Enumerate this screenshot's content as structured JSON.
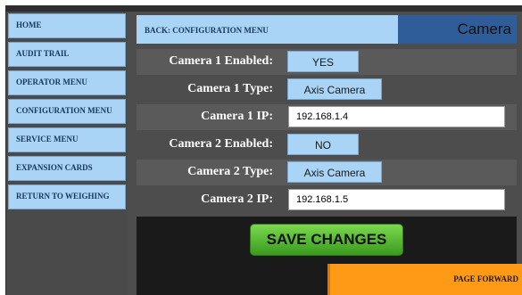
{
  "sidebar": {
    "items": [
      {
        "label": "HOME"
      },
      {
        "label": "AUDIT TRAIL"
      },
      {
        "label": "OPERATOR MENU"
      },
      {
        "label": "CONFIGURATION MENU"
      },
      {
        "label": "SERVICE MENU"
      },
      {
        "label": "EXPANSION CARDS"
      },
      {
        "label": "RETURN TO WEIGHING"
      }
    ]
  },
  "header": {
    "back_label": "BACK: CONFIGURATION MENU",
    "title": "Camera"
  },
  "settings": {
    "camera1_enabled": {
      "label": "Camera 1 Enabled:",
      "value": "YES"
    },
    "camera1_type": {
      "label": "Camera 1 Type:",
      "value": "Axis Camera"
    },
    "camera1_ip": {
      "label": "Camera 1 IP:",
      "value": "192.168.1.4"
    },
    "camera2_enabled": {
      "label": "Camera 2 Enabled:",
      "value": "NO"
    },
    "camera2_type": {
      "label": "Camera 2 Type:",
      "value": "Axis Camera"
    },
    "camera2_ip": {
      "label": "Camera 2 IP:",
      "value": "192.168.1.5"
    }
  },
  "actions": {
    "save_label": "SAVE CHANGES",
    "page_forward_label": "PAGE FORWARD"
  },
  "colors": {
    "button_blue": "#a9d4f5",
    "header_blue": "#2e5d99",
    "save_green": "#5cc23a",
    "page_forward_orange": "#ff9a16"
  }
}
